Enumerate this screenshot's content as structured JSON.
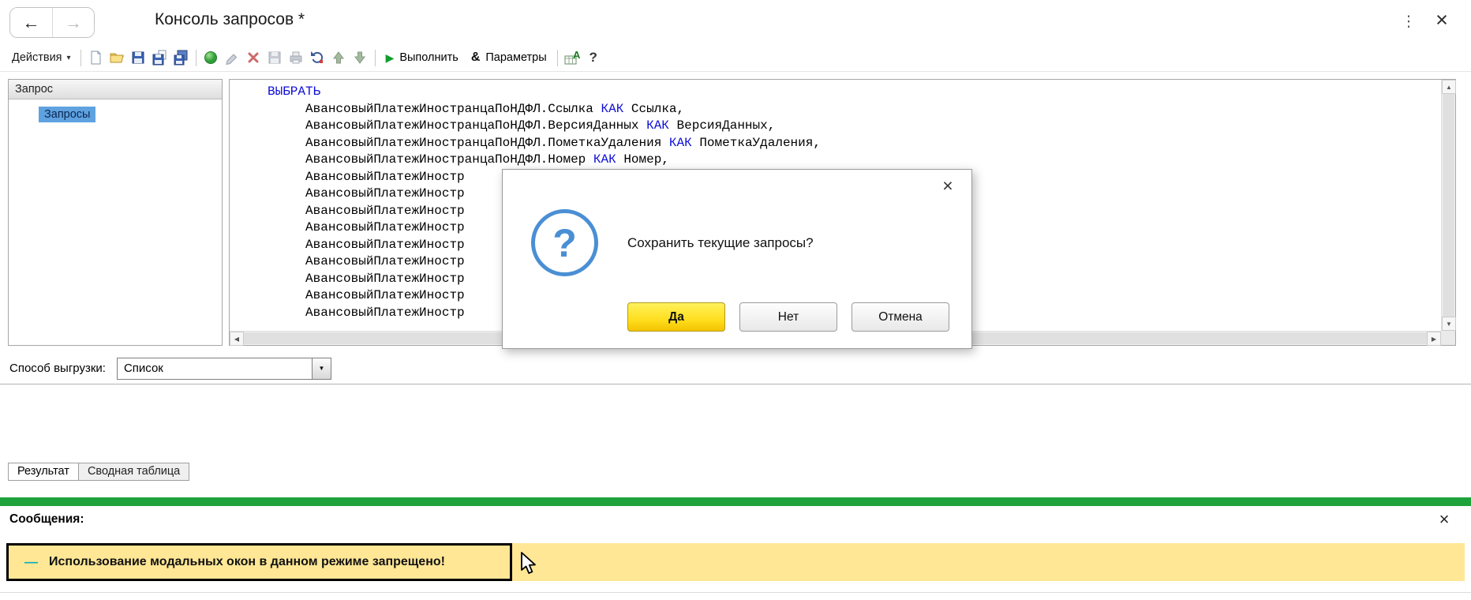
{
  "window": {
    "title": "Консоль запросов *"
  },
  "icons": {
    "back": "←",
    "forward": "→",
    "kebab": "⋮",
    "close": "×",
    "caret_down": "▾",
    "combo_caret": "▼",
    "play": "▶",
    "ampersand": "&",
    "question": "?",
    "help": "?",
    "letter_a": "А",
    "dash": "—",
    "scroll_up": "▲",
    "scroll_down": "▼",
    "scroll_left": "◀",
    "scroll_right": "▶"
  },
  "toolbar": {
    "actions_label": "Действия",
    "run_label": "Выполнить",
    "params_label": "Параметры"
  },
  "query_panel": {
    "header": "Запрос",
    "tree_items": [
      {
        "label": "Запросы",
        "selected": true
      }
    ]
  },
  "code": {
    "keywords": [
      "ВЫБРАТЬ",
      "КАК"
    ],
    "lines": [
      "ВЫБРАТЬ",
      "\tАвансовыйПлатежИностранцаПоНДФЛ.Ссылка КАК Ссылка,",
      "\tАвансовыйПлатежИностранцаПоНДФЛ.ВерсияДанных КАК ВерсияДанных,",
      "\tАвансовыйПлатежИностранцаПоНДФЛ.ПометкаУдаления КАК ПометкаУдаления,",
      "\tАвансовыйПлатежИностранцаПоНДФЛ.Номер КАК Номер,",
      "\tАвансовыйПлатежИностр",
      "\tАвансовыйПлатежИностр",
      "\tАвансовыйПлатежИностр",
      "\tАвансовыйПлатежИностр",
      "\tАвансовыйПлатежИностр",
      "\tАвансовыйПлатежИностр",
      "\tАвансовыйПлатежИностр",
      "\tАвансовыйПлатежИностр",
      "\tАвансовыйПлатежИностр"
    ]
  },
  "dialog": {
    "message": "Сохранить текущие запросы?",
    "buttons": [
      {
        "label": "Да",
        "default": true
      },
      {
        "label": "Нет",
        "default": false
      },
      {
        "label": "Отмена",
        "default": false
      }
    ]
  },
  "export_row": {
    "label": "Способ выгрузки:",
    "value": "Список"
  },
  "result_tabs": [
    {
      "label": "Результат",
      "active": true
    },
    {
      "label": "Сводная таблица",
      "active": false
    }
  ],
  "messages": {
    "header": "Сообщения:",
    "items": [
      {
        "text": "Использование модальных окон в данном режиме запрещено!",
        "focused": true
      }
    ]
  },
  "colors": {
    "keyword": "#0d0dd6",
    "green_bar": "#1ea33c",
    "message_bg": "#ffe795",
    "selection": "#5ea2e0",
    "dash": "#00b0bc",
    "dialog_blue": "#4a8fd4"
  }
}
